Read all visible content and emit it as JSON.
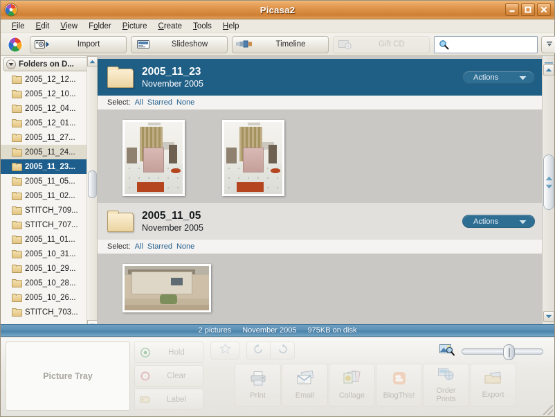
{
  "window": {
    "title": "Picasa2",
    "logo_icon": "picasa-logo-icon",
    "minimize_label": "Minimize",
    "maximize_label": "Maximize",
    "close_label": "Close"
  },
  "menubar": {
    "items": [
      {
        "label": "File",
        "accel": "F"
      },
      {
        "label": "Edit",
        "accel": "E"
      },
      {
        "label": "View",
        "accel": "V"
      },
      {
        "label": "Folder",
        "accel": "o"
      },
      {
        "label": "Picture",
        "accel": "P"
      },
      {
        "label": "Create",
        "accel": "C"
      },
      {
        "label": "Tools",
        "accel": "T"
      },
      {
        "label": "Help",
        "accel": "H"
      }
    ]
  },
  "toolbar": {
    "logo_icon": "picasa-logo-icon",
    "buttons": [
      {
        "label": "Import",
        "icon": "camera-import-icon",
        "enabled": true
      },
      {
        "label": "Slideshow",
        "icon": "slideshow-icon",
        "enabled": true
      },
      {
        "label": "Timeline",
        "icon": "timeline-icon",
        "enabled": true
      },
      {
        "label": "Gift CD",
        "icon": "gift-cd-icon",
        "enabled": false
      }
    ],
    "search": {
      "value": "",
      "placeholder": "",
      "icon": "search-icon"
    },
    "filter_button_icon": "filter-funnel-icon"
  },
  "sidebar": {
    "header": {
      "label": "Folders on D...",
      "icon": "chevron-down-circle-icon"
    },
    "items": [
      {
        "label": "2005_12_12...",
        "state": "normal"
      },
      {
        "label": "2005_12_10...",
        "state": "normal"
      },
      {
        "label": "2005_12_04...",
        "state": "normal"
      },
      {
        "label": "2005_12_01...",
        "state": "normal"
      },
      {
        "label": "2005_11_27...",
        "state": "normal"
      },
      {
        "label": "2005_11_24...",
        "state": "hover"
      },
      {
        "label": "2005_11_23...",
        "state": "selected"
      },
      {
        "label": "2005_11_05...",
        "state": "normal"
      },
      {
        "label": "2005_11_02...",
        "state": "normal"
      },
      {
        "label": "STITCH_709...",
        "state": "normal"
      },
      {
        "label": "STITCH_707...",
        "state": "normal"
      },
      {
        "label": "2005_11_01...",
        "state": "normal"
      },
      {
        "label": "2005_10_31...",
        "state": "normal"
      },
      {
        "label": "2005_10_29...",
        "state": "normal"
      },
      {
        "label": "2005_10_28...",
        "state": "normal"
      },
      {
        "label": "2005_10_26...",
        "state": "normal"
      },
      {
        "label": "STITCH_703...",
        "state": "normal"
      }
    ]
  },
  "main": {
    "groups": [
      {
        "title": "2005_11_23",
        "subtitle": "November 2005",
        "highlighted": true,
        "actions_label": "Actions",
        "select_label": "Select:",
        "select_links": [
          "All",
          "Starred",
          "None"
        ],
        "thumbnails": [
          {
            "alt": "living-room-photo-1"
          },
          {
            "alt": "living-room-photo-2"
          }
        ]
      },
      {
        "title": "2005_11_05",
        "subtitle": "November 2005",
        "highlighted": false,
        "actions_label": "Actions",
        "select_label": "Select:",
        "select_links": [
          "All",
          "Starred",
          "None"
        ],
        "thumbnails": [
          {
            "alt": "house-exterior-photo"
          }
        ]
      }
    ]
  },
  "statusbar": {
    "picture_count": "2 pictures",
    "date": "November 2005",
    "disk_usage": "975KB on disk"
  },
  "bottom": {
    "tray_label": "Picture Tray",
    "side_buttons": [
      {
        "label": "Hold",
        "icon": "hold-target-icon"
      },
      {
        "label": "Clear",
        "icon": "clear-circle-icon"
      },
      {
        "label": "Label",
        "icon": "label-tag-icon"
      }
    ],
    "star_button_icon": "star-icon",
    "rotate_left_icon": "rotate-left-icon",
    "rotate_right_icon": "rotate-right-icon",
    "action_buttons": [
      {
        "label": "Print",
        "icon": "printer-icon"
      },
      {
        "label": "Email",
        "icon": "email-icon"
      },
      {
        "label": "Collage",
        "icon": "collage-icon"
      },
      {
        "label": "BlogThis!",
        "icon": "blogger-icon"
      },
      {
        "label": "Order\nPrints",
        "label_line1": "Order",
        "label_line2": "Prints",
        "icon": "order-prints-icon"
      },
      {
        "label": "Export",
        "icon": "export-icon"
      }
    ],
    "zoom_icon": "zoom-photo-icon",
    "zoom_slider_value": 51
  },
  "colors": {
    "titlebar_accent": "#d98d43",
    "group_header_active": "#1f5f86",
    "group_header_inactive": "#e2e0dc",
    "sidebar_selection": "#1d5e8c",
    "statusbar": "#5e93b8",
    "link": "#25618f"
  }
}
